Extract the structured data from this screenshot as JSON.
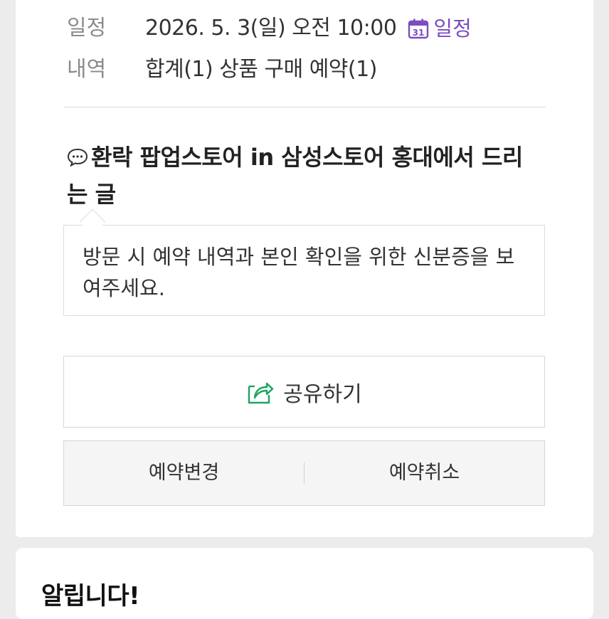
{
  "details": {
    "date_label": "일정",
    "date_value": "2026. 5. 3(일) 오전 10:00",
    "schedule_link_label": "일정",
    "calendar_icon_number": "31",
    "history_label": "내역",
    "history_value": "합계(1) 상품 구매 예약(1)"
  },
  "notice": {
    "title": "환락 팝업스토어 in 삼성스토어 홍대에서 드리는 글",
    "message": "방문 시 예약 내역과 본인 확인을 위한 신분증을 보여주세요."
  },
  "actions": {
    "share_label": "공유하기",
    "change_label": "예약변경",
    "cancel_label": "예약취소"
  },
  "announcement": {
    "title": "알립니다!"
  },
  "colors": {
    "accent_purple": "#7b4cc2",
    "share_green": "#1ea362"
  }
}
